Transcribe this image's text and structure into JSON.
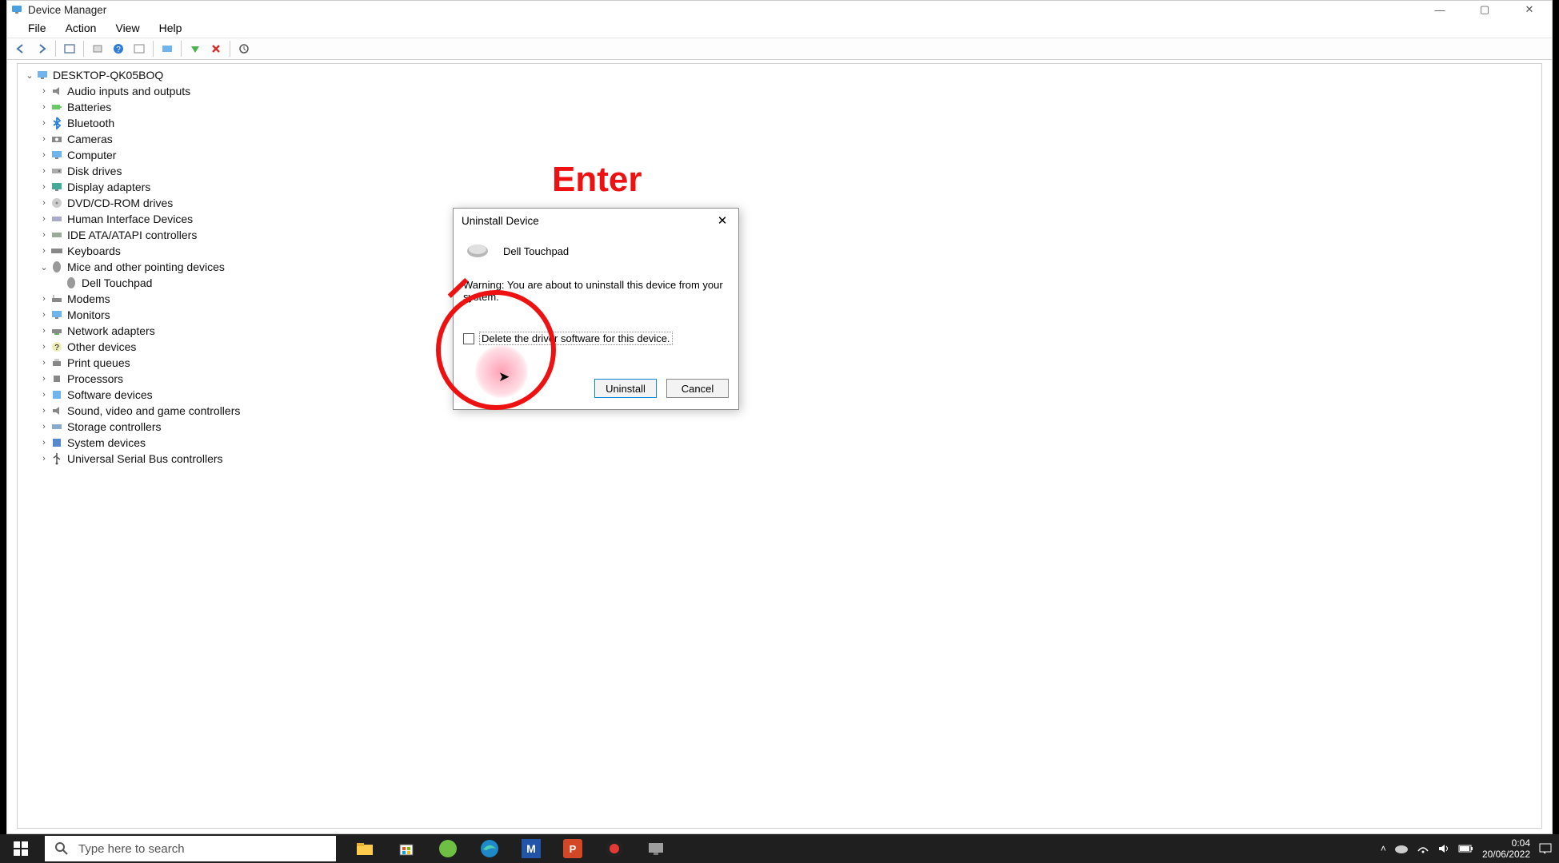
{
  "window": {
    "title": "Device Manager",
    "menus": [
      "File",
      "Action",
      "View",
      "Help"
    ],
    "controls": {
      "min": "—",
      "max": "▢",
      "close": "✕"
    }
  },
  "tree": {
    "root": "DESKTOP-QK05BOQ",
    "categories": [
      {
        "label": "Audio inputs and outputs",
        "icon": "audio"
      },
      {
        "label": "Batteries",
        "icon": "battery"
      },
      {
        "label": "Bluetooth",
        "icon": "bluetooth"
      },
      {
        "label": "Cameras",
        "icon": "camera"
      },
      {
        "label": "Computer",
        "icon": "computer"
      },
      {
        "label": "Disk drives",
        "icon": "disk"
      },
      {
        "label": "Display adapters",
        "icon": "display"
      },
      {
        "label": "DVD/CD-ROM drives",
        "icon": "dvd"
      },
      {
        "label": "Human Interface Devices",
        "icon": "hid"
      },
      {
        "label": "IDE ATA/ATAPI controllers",
        "icon": "ide"
      },
      {
        "label": "Keyboards",
        "icon": "keyboard"
      },
      {
        "label": "Mice and other pointing devices",
        "icon": "mouse",
        "expanded": true,
        "children": [
          {
            "label": "Dell Touchpad",
            "icon": "mouse"
          }
        ]
      },
      {
        "label": "Modems",
        "icon": "modem"
      },
      {
        "label": "Monitors",
        "icon": "monitor"
      },
      {
        "label": "Network adapters",
        "icon": "network"
      },
      {
        "label": "Other devices",
        "icon": "other"
      },
      {
        "label": "Print queues",
        "icon": "printer"
      },
      {
        "label": "Processors",
        "icon": "cpu"
      },
      {
        "label": "Software devices",
        "icon": "software"
      },
      {
        "label": "Sound, video and game controllers",
        "icon": "sound"
      },
      {
        "label": "Storage controllers",
        "icon": "storage"
      },
      {
        "label": "System devices",
        "icon": "system"
      },
      {
        "label": "Universal Serial Bus controllers",
        "icon": "usb"
      }
    ]
  },
  "annotation": {
    "text": "Enter"
  },
  "dialog": {
    "title": "Uninstall Device",
    "device_name": "Dell Touchpad",
    "warning": "Warning: You are about to uninstall this device from your system.",
    "checkbox_label": "Delete the driver software for this device.",
    "buttons": {
      "primary": "Uninstall",
      "secondary": "Cancel"
    },
    "close": "✕"
  },
  "taskbar": {
    "search_placeholder": "Type here to search",
    "clock": {
      "time": "0:04",
      "date": "20/06/2022"
    }
  }
}
